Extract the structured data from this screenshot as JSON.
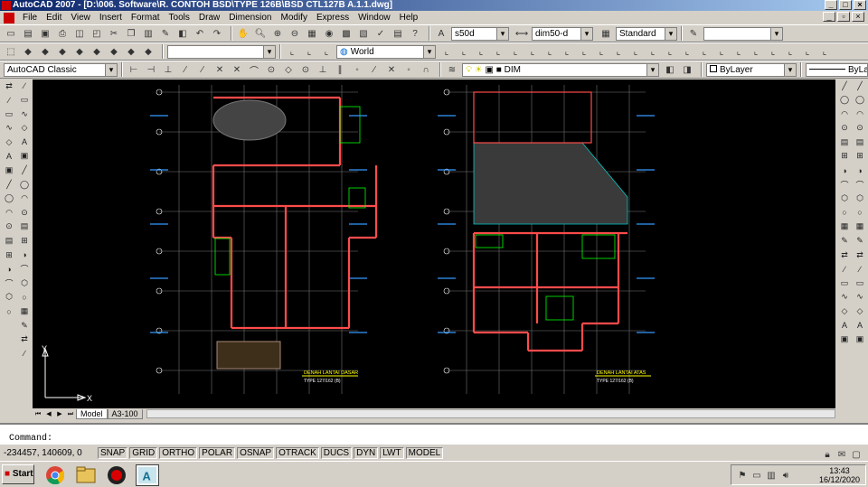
{
  "window": {
    "title": "AutoCAD 2007 - [D:\\006. Software\\R. CONTOH BSD\\TYPE 126B\\BSD CTL127B A.1.1.dwg]"
  },
  "menu": [
    "File",
    "Edit",
    "View",
    "Insert",
    "Format",
    "Tools",
    "Draw",
    "Dimension",
    "Modify",
    "Express",
    "Window",
    "Help"
  ],
  "toolbar1": {
    "dim_text_style": "s50d",
    "dim_style": "dim50-d",
    "table_style": "Standard"
  },
  "toolbar2": {
    "ucs": "World"
  },
  "toolbar3": {
    "workspace": "AutoCAD Classic",
    "layer": "DIM",
    "color": "ByLayer",
    "linetype": "ByLayer"
  },
  "drawing": {
    "left_title": "DENAH LANTAI DASAR",
    "left_subtitle": "TYPE 127/162 (B)",
    "right_title": "DENAH LANTAI ATAS",
    "right_subtitle": "TYPE 127/162 (B)",
    "ucs_x": "X",
    "ucs_y": "Y"
  },
  "tabs": [
    "Model",
    "A3-100"
  ],
  "command": {
    "prompt": "Command:"
  },
  "status": {
    "coordinates": "-234457, 140609, 0",
    "buttons": [
      "SNAP",
      "GRID",
      "ORTHO",
      "POLAR",
      "OSNAP",
      "OTRACK",
      "DUCS",
      "DYN",
      "LWT",
      "MODEL"
    ]
  },
  "taskbar": {
    "start": "Start",
    "time": "13:43",
    "date": "16/12/2020"
  }
}
